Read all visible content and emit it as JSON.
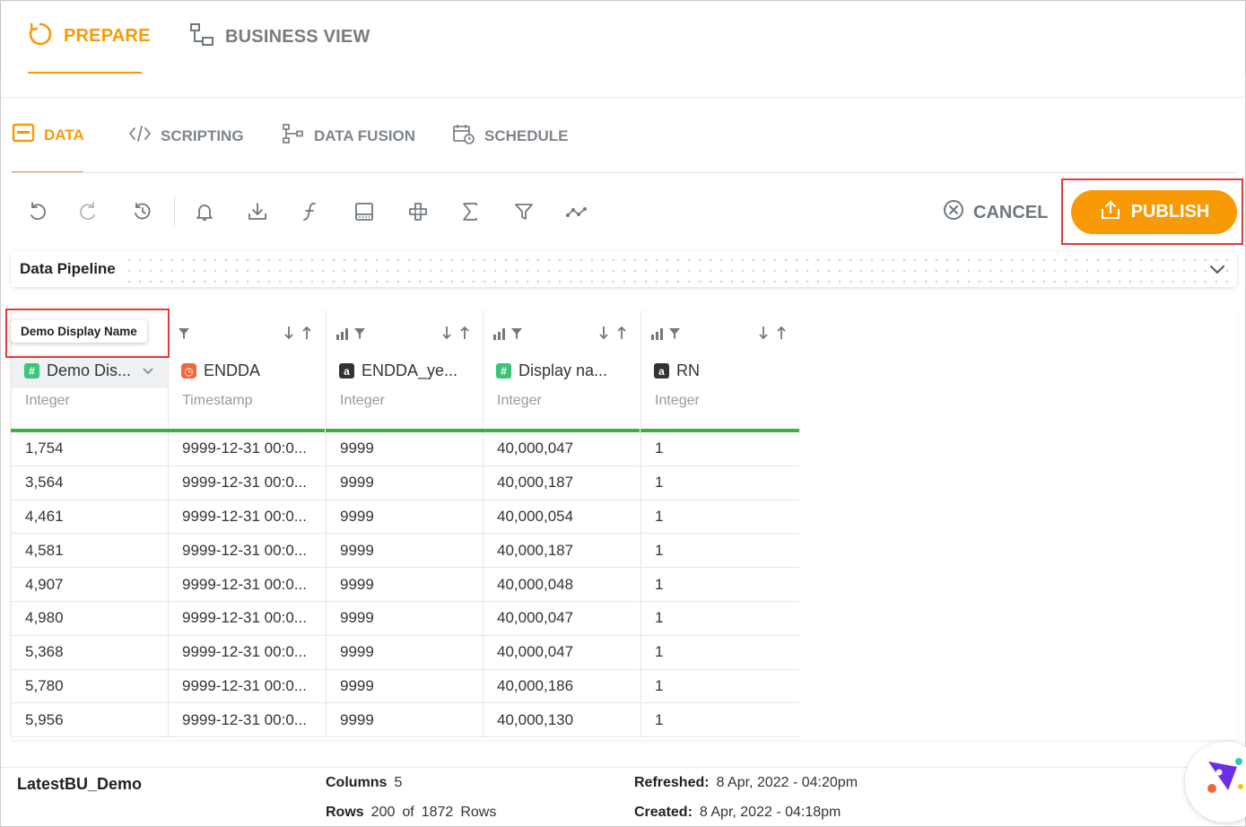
{
  "top_tabs": [
    {
      "label": "PREPARE",
      "active": true
    },
    {
      "label": "BUSINESS VIEW",
      "active": false
    }
  ],
  "sub_tabs": [
    {
      "label": "DATA",
      "active": true
    },
    {
      "label": "SCRIPTING",
      "active": false
    },
    {
      "label": "DATA FUSION",
      "active": false
    },
    {
      "label": "SCHEDULE",
      "active": false
    }
  ],
  "toolbar": {
    "icons": [
      "undo-icon",
      "redo-icon",
      "history-icon",
      "bell-icon",
      "download-icon",
      "function-icon",
      "calculator-icon",
      "plus-box-icon",
      "sigma-icon",
      "filter-icon",
      "graph-icon"
    ],
    "cancel_label": "CANCEL",
    "publish_label": "PUBLISH"
  },
  "pipeline": {
    "label": "Data Pipeline"
  },
  "tooltip": "Demo Display Name",
  "columns": [
    {
      "name": "Demo Dis...",
      "type": "Integer",
      "badge": "#",
      "badge_kind": "num",
      "values": [
        "1,754",
        "3,564",
        "4,461",
        "4,581",
        "4,907",
        "4,980",
        "5,368",
        "5,780",
        "5,956"
      ]
    },
    {
      "name": "ENDDA",
      "type": "Timestamp",
      "badge": "◷",
      "badge_kind": "time",
      "values": [
        "9999-12-31 00:0...",
        "9999-12-31 00:0...",
        "9999-12-31 00:0...",
        "9999-12-31 00:0...",
        "9999-12-31 00:0...",
        "9999-12-31 00:0...",
        "9999-12-31 00:0...",
        "9999-12-31 00:0...",
        "9999-12-31 00:0..."
      ]
    },
    {
      "name": "ENDDA_ye...",
      "type": "Integer",
      "badge": "a",
      "badge_kind": "txt",
      "values": [
        "9999",
        "9999",
        "9999",
        "9999",
        "9999",
        "9999",
        "9999",
        "9999",
        "9999"
      ]
    },
    {
      "name": "Display na...",
      "type": "Integer",
      "badge": "#",
      "badge_kind": "num",
      "values": [
        "40,000,047",
        "40,000,187",
        "40,000,054",
        "40,000,187",
        "40,000,048",
        "40,000,047",
        "40,000,047",
        "40,000,186",
        "40,000,130"
      ]
    },
    {
      "name": "RN",
      "type": "Integer",
      "badge": "a",
      "badge_kind": "txt",
      "values": [
        "1",
        "1",
        "1",
        "1",
        "1",
        "1",
        "1",
        "1",
        "1"
      ]
    }
  ],
  "footer": {
    "dataset_name": "LatestBU_Demo",
    "columns_label": "Columns",
    "columns_value": "5",
    "rows_label": "Rows",
    "rows_value": "200",
    "rows_of": "of",
    "rows_total": "1872",
    "rows_suffix": "Rows",
    "refreshed_label": "Refreshed:",
    "refreshed_value": "8 Apr, 2022 - 04:20pm",
    "created_label": "Created:",
    "created_value": "8 Apr, 2022 - 04:18pm"
  },
  "colors": {
    "accent": "#f79a05",
    "highlight": "#e23b3b",
    "green": "#3cae49"
  }
}
